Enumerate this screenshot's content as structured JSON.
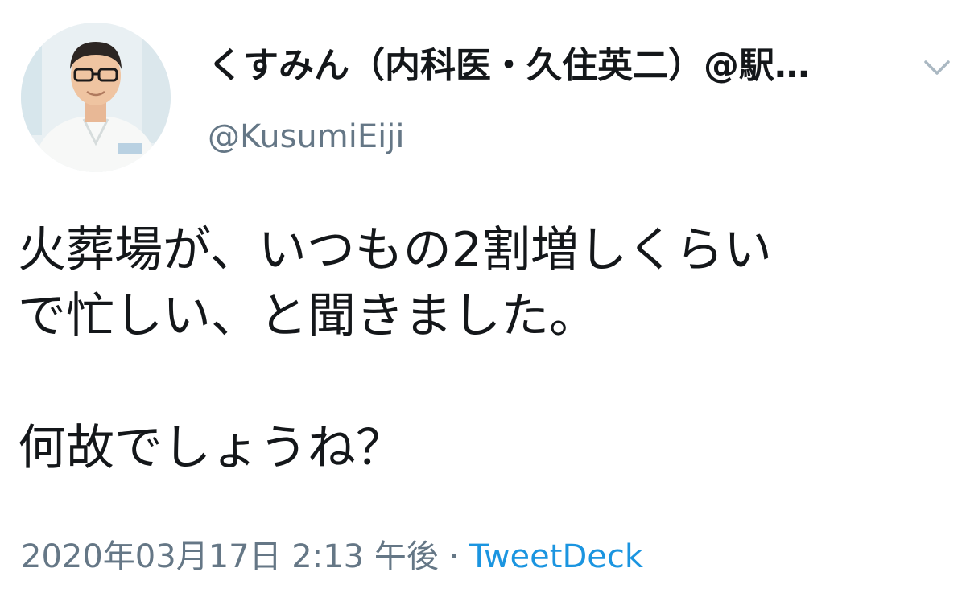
{
  "author": {
    "display_name": "くすみん（内科医・久住英二）@駅…",
    "handle": "@KusumiEiji",
    "avatar": "profile-photo"
  },
  "tweet": {
    "lines": [
      "火葬場が、いつもの2割増しくらい",
      "で忙しい、と聞きました。",
      "",
      "何故でしょうね？"
    ]
  },
  "meta": {
    "timestamp": "2020年03月17日 2:13 午後",
    "separator": " · ",
    "source": "TweetDeck"
  },
  "icons": {
    "more_menu": "chevron-down-icon"
  },
  "colors": {
    "text_primary": "#14171a",
    "text_secondary": "#657786",
    "link": "#1b95e0",
    "chevron": "#aab8c2"
  }
}
